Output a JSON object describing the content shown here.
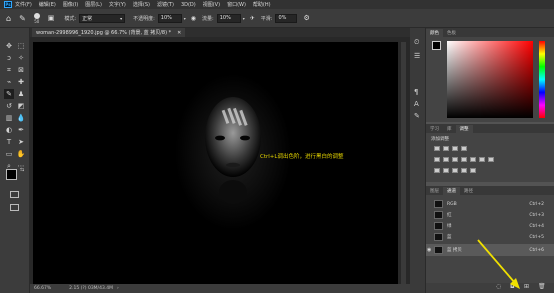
{
  "menubar": {
    "logo": "Ps",
    "items": [
      "文件(F)",
      "编辑(E)",
      "图像(I)",
      "图层(L)",
      "文字(Y)",
      "选择(S)",
      "滤镜(T)",
      "3D(D)",
      "视图(V)",
      "窗口(W)",
      "帮助(H)"
    ]
  },
  "options": {
    "brush_size": "50",
    "mode_label": "模式:",
    "mode_value": "正常",
    "opacity_label": "不透明度:",
    "opacity_value": "10%",
    "flow_label": "流量:",
    "flow_value": "10%",
    "smooth_label": "平滑:",
    "smooth_value": "0%"
  },
  "document": {
    "tab_title": "woman-2998996_1920.jpg @ 66.7% (背景, 蓝 拷贝/8) *",
    "annotation": "Ctrl+L调出色阶，进行黑白的调整"
  },
  "status": {
    "zoom": "66.67%",
    "doc_size": "2.15 (?) 03M/43.4M"
  },
  "color_panel": {
    "tabs": [
      "颜色",
      "色板"
    ]
  },
  "adjust_panel": {
    "tabs": [
      "学习",
      "库",
      "调整"
    ],
    "title": "添加调整"
  },
  "channels_panel": {
    "tabs": [
      "图层",
      "通道",
      "路径"
    ],
    "channels": [
      {
        "name": "RGB",
        "shortcut": "Ctrl+2"
      },
      {
        "name": "红",
        "shortcut": "Ctrl+3"
      },
      {
        "name": "绿",
        "shortcut": "Ctrl+4"
      },
      {
        "name": "蓝",
        "shortcut": "Ctrl+5"
      },
      {
        "name": "蓝 拷贝",
        "shortcut": "Ctrl+6"
      }
    ]
  },
  "colors": {
    "annotation": "#e8d700",
    "arrow": "#f0e000",
    "selected_row": "#5a5a5a"
  }
}
